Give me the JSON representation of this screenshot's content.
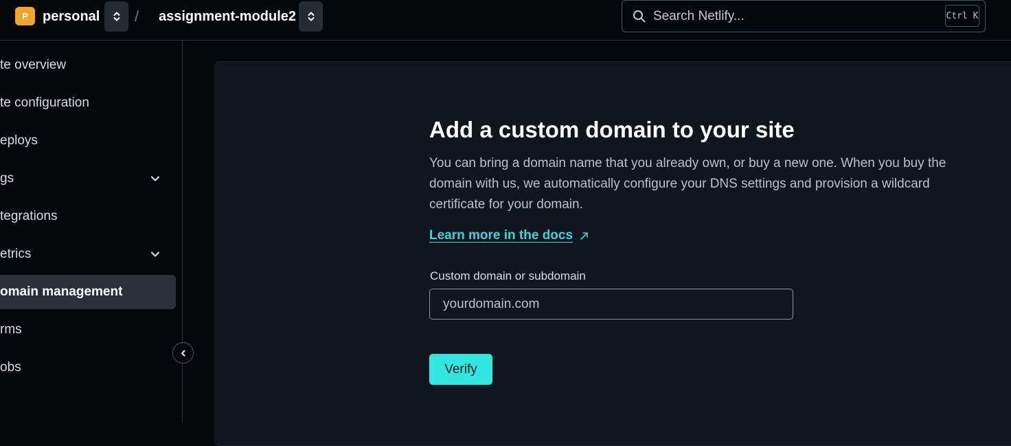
{
  "header": {
    "team_initial": "P",
    "team_name": "personal",
    "separator": "/",
    "site_name": "assignment-module2",
    "search_placeholder": "Search Netlify...",
    "search_shortcut": "Ctrl K"
  },
  "sidebar": {
    "items": [
      {
        "label": "te overview",
        "expandable": false,
        "active": false
      },
      {
        "label": "te configuration",
        "expandable": false,
        "active": false
      },
      {
        "label": "eploys",
        "expandable": false,
        "active": false
      },
      {
        "label": "gs",
        "expandable": true,
        "active": false
      },
      {
        "label": "tegrations",
        "expandable": false,
        "active": false
      },
      {
        "label": "etrics",
        "expandable": true,
        "active": false
      },
      {
        "label": "omain management",
        "expandable": false,
        "active": true
      },
      {
        "label": "rms",
        "expandable": false,
        "active": false
      },
      {
        "label": "obs",
        "expandable": false,
        "active": false
      }
    ]
  },
  "main": {
    "title": "Add a custom domain to your site",
    "description": "You can bring a domain name that you already own, or buy a new one. When you buy the domain with us, we automatically configure your DNS settings and provision a wildcard certificate for your domain.",
    "docs_link": "Learn more in the docs",
    "field_label": "Custom domain or subdomain",
    "field_placeholder": "yourdomain.com",
    "field_value": "",
    "verify_label": "Verify"
  },
  "colors": {
    "accent": "#32e6e2",
    "link": "#3cd4e0",
    "team_avatar": "#f0a52b",
    "background": "#05080b",
    "panel": "#11161d"
  }
}
